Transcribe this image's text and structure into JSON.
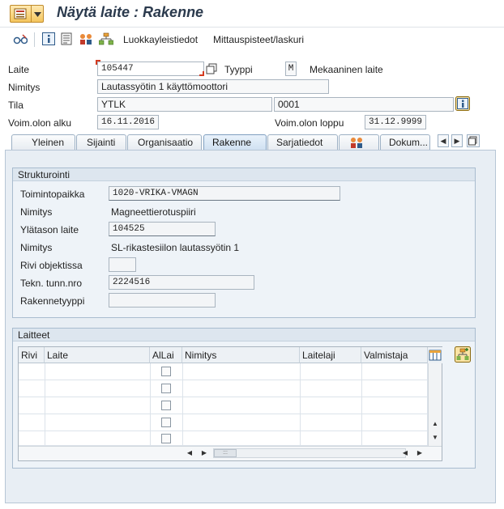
{
  "window": {
    "title": "Näytä laite : Rakenne"
  },
  "toolbar": {
    "classification_label": "Luokkayleistiedot",
    "measuring_label": "Mittauspisteet/laskuri"
  },
  "header": {
    "laite_label": "Laite",
    "laite_value": "105447",
    "tyyppi_label": "Tyyppi",
    "tyyppi_code": "M",
    "tyyppi_desc": "Mekaaninen laite",
    "nimitys_label": "Nimitys",
    "nimitys_value": "Lautassyötin 1 käyttömoottori",
    "tila_label": "Tila",
    "tila_value": "YTLK",
    "tila_value2": "0001",
    "valid_from_label": "Voim.olon alku",
    "valid_from_value": "16.11.2016",
    "valid_to_label": "Voim.olon loppu",
    "valid_to_value": "31.12.9999"
  },
  "tabs": [
    {
      "label": "Yleinen",
      "active": false
    },
    {
      "label": "Sijainti",
      "active": false
    },
    {
      "label": "Organisaatio",
      "active": false
    },
    {
      "label": "Rakenne",
      "active": true
    },
    {
      "label": "Sarjatiedot",
      "active": false
    },
    {
      "label": "",
      "icon": "partners-icon",
      "active": false
    },
    {
      "label": "Dokum...",
      "active": false
    }
  ],
  "structure": {
    "title": "Strukturointi",
    "toimintopaikka_label": "Toimintopaikka",
    "toimintopaikka_value": "1020-VRIKA-VMAGN",
    "nimitys1_label": "Nimitys",
    "nimitys1_value": "Magneettierotuspiiri",
    "ylataso_label": "Ylätason laite",
    "ylataso_value": "104525",
    "nimitys2_label": "Nimitys",
    "nimitys2_value": "SL-rikastesiilon lautassyötin 1",
    "rivi_label": "Rivi objektissa",
    "rivi_value": "",
    "tekn_label": "Tekn. tunn.nro",
    "tekn_value": "2224516",
    "rakennetyyppi_label": "Rakennetyyppi",
    "rakennetyyppi_value": ""
  },
  "equipment": {
    "title": "Laitteet",
    "columns": [
      "Rivi",
      "Laite",
      "AlLai",
      "Nimitys",
      "Laitelaji",
      "Valmistaja"
    ],
    "rows": [
      {
        "rivi": "",
        "laite": "",
        "allai": false,
        "nimitys": "",
        "laitelaji": "",
        "valmistaja": ""
      },
      {
        "rivi": "",
        "laite": "",
        "allai": false,
        "nimitys": "",
        "laitelaji": "",
        "valmistaja": ""
      },
      {
        "rivi": "",
        "laite": "",
        "allai": false,
        "nimitys": "",
        "laitelaji": "",
        "valmistaja": ""
      },
      {
        "rivi": "",
        "laite": "",
        "allai": false,
        "nimitys": "",
        "laitelaji": "",
        "valmistaja": ""
      },
      {
        "rivi": "",
        "laite": "",
        "allai": false,
        "nimitys": "",
        "laitelaji": "",
        "valmistaja": ""
      }
    ]
  },
  "colors": {
    "accent": "#f4c65e",
    "panel": "#e8eef4",
    "required_marker": "#d43a1f"
  }
}
